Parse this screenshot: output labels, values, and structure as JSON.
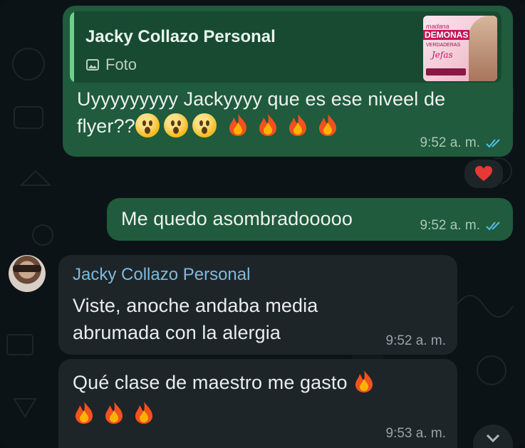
{
  "chat": {
    "outgoing_reply": {
      "quoted_name": "Jacky Collazo Personal",
      "quoted_type": "Foto",
      "thumbnail_text": {
        "line1": "madana",
        "line2": "DEMONAS",
        "line3": "VERDADERAS",
        "line4": "Jefas"
      },
      "text_line1": "Uyyyyyyyyy Jackyyyy  que es ese niveel de",
      "text_line2": "flyer??",
      "time": "9:52 a. m.",
      "reaction": "heart"
    },
    "outgoing_second": {
      "text": "Me quedo asombradooooo",
      "time": "9:52 a. m."
    },
    "incoming_first": {
      "sender": "Jacky Collazo Personal",
      "text_line1": "Viste, anoche andaba media",
      "text_line2": "abrumada con la alergia",
      "time": "9:52 a. m."
    },
    "incoming_second": {
      "text": "Qué clase de maestro me gasto",
      "time": "9:53 a. m."
    }
  },
  "colors": {
    "outgoing_bubble": "#1f5b3c",
    "incoming_bubble": "#1e2529",
    "read_ticks": "#53bdeb",
    "sender_name": "#7fb9dc"
  },
  "icons": {
    "photo": "photo-icon",
    "read": "double-check-icon",
    "reaction": "red-heart",
    "scroll": "chevron-down-icon"
  }
}
